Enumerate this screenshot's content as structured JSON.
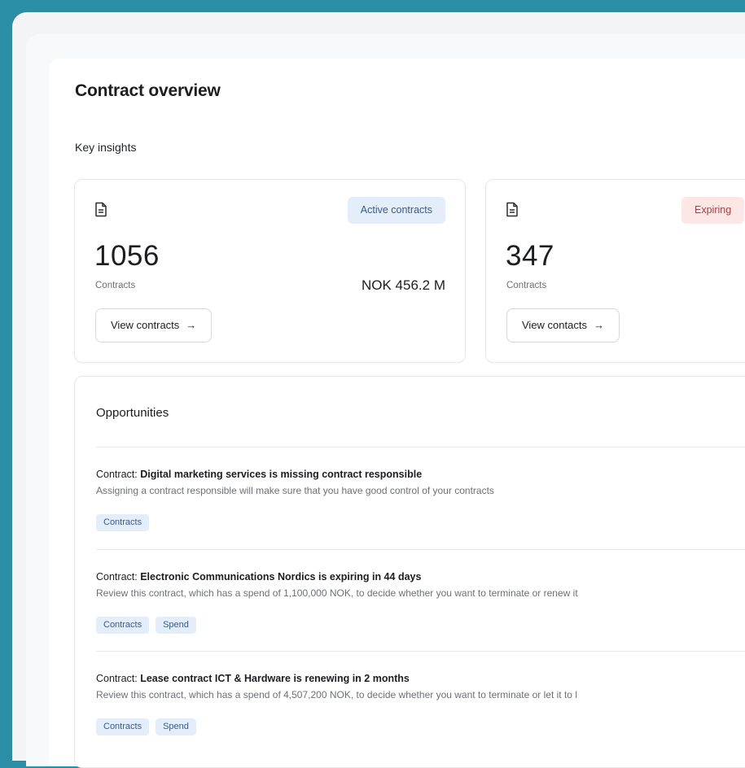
{
  "page_title": "Contract overview",
  "section_label": "Key insights",
  "cards": [
    {
      "badge": "Active contracts",
      "count": "1056",
      "count_label": "Contracts",
      "amount": "NOK 456.2 M",
      "button_label": "View contracts",
      "icon": "document-icon"
    },
    {
      "badge": "Expiring",
      "count": "347",
      "count_label": "Contracts",
      "button_label": "View contacts",
      "icon": "document-icon"
    }
  ],
  "opportunities": {
    "title": "Opportunities",
    "items": [
      {
        "prefix": "Contract: ",
        "name": "Digital marketing services",
        "suffix": " is missing contract responsible",
        "description": "Assigning a contract responsible will make sure that you have good control of your contracts",
        "tags": [
          "Contracts"
        ]
      },
      {
        "prefix": "Contract: ",
        "name": "Electronic Communications Nordics",
        "suffix": " is expiring in 44 days",
        "description": "Review this contract, which has a spend of 1,100,000 NOK, to decide whether you want to terminate or renew it",
        "tags": [
          "Contracts",
          "Spend"
        ]
      },
      {
        "prefix": "Contract: ",
        "name": "Lease contract ICT & Hardware",
        "suffix": " is renewing in 2 months",
        "description": "Review this contract, which has a spend of 4,507,200 NOK, to decide whether you want to terminate or let it to l",
        "tags": [
          "Contracts",
          "Spend"
        ]
      }
    ]
  },
  "colors": {
    "background": "#2a8fa6",
    "badge_blue": "#e4eefb",
    "badge_red": "#fde6e6"
  }
}
